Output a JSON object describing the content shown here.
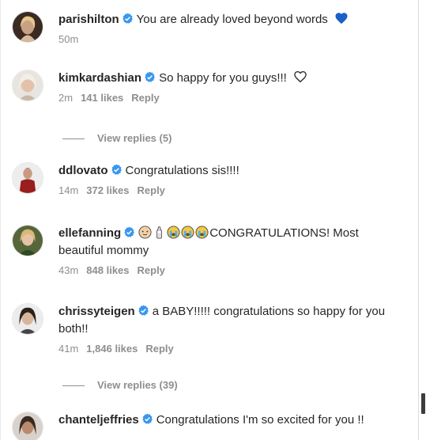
{
  "colors": {
    "verified_badge": "#3897f0",
    "blue_heart": "#1b5fc8",
    "meta_text": "#8e8e8e"
  },
  "comments": [
    {
      "username": "parishilton",
      "text": "You are already loved beyond words",
      "trailing_icon": "blue-heart-icon",
      "time": "50m",
      "likes": "",
      "reply": ""
    },
    {
      "username": "kimkardashian",
      "text": "So happy for you guys!!!",
      "trailing_icon": "heart-outline-icon",
      "time": "2m",
      "likes": "141 likes",
      "reply": "Reply"
    },
    {
      "username": "ddlovato",
      "text": "Congratulations sis!!!!",
      "time": "14m",
      "likes": "372 likes",
      "reply": "Reply"
    },
    {
      "username": "ellefanning",
      "emojis": [
        "baby-face-emoji",
        "baby-bottle-emoji",
        "crying-face-emoji",
        "crying-face-emoji",
        "crying-face-emoji"
      ],
      "text": "CONGRATULATIONS! Most",
      "text_line2": "beautiful mommy",
      "time": "43m",
      "likes": "848 likes",
      "reply": "Reply"
    },
    {
      "username": "chrissyteigen",
      "text": "a BABY!!!!! congratulations so happy for you",
      "text_line2": "both!!",
      "time": "41m",
      "likes": "1,846 likes",
      "reply": "Reply"
    },
    {
      "username": "chanteljeffries",
      "text": "Congratulations I'm so excited for you !!"
    }
  ],
  "view_replies": [
    {
      "label": "View replies (5)"
    },
    {
      "label": "View replies (39)"
    }
  ]
}
